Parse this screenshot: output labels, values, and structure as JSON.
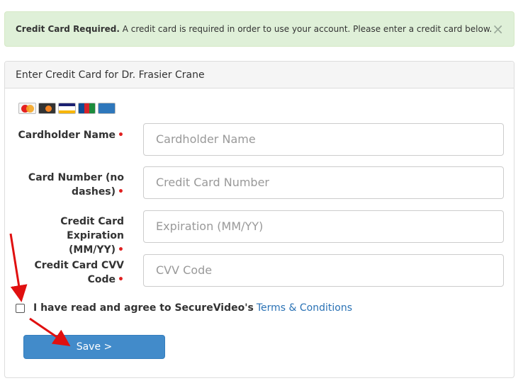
{
  "alert": {
    "title": "Credit Card Required.",
    "message": " A credit card is required in order to use your account. Please enter a credit card below.",
    "close_glyph": "×"
  },
  "panel": {
    "heading": "Enter Credit Card for Dr. Frasier Crane"
  },
  "card_logos": [
    "mastercard-icon",
    "discover-icon",
    "visa-icon",
    "jcb-icon",
    "amex-icon"
  ],
  "fields": {
    "cardholder_name": {
      "label": "Cardholder Name",
      "placeholder": "Cardholder Name"
    },
    "card_number": {
      "label_line1": "Card Number (no",
      "label_line2": "dashes)",
      "placeholder": "Credit Card Number"
    },
    "expiration": {
      "label_line1": "Credit Card Expiration",
      "label_line2": "(MM/YY)",
      "placeholder": "Expiration (MM/YY)"
    },
    "cvv": {
      "label_line1": "Credit Card CVV",
      "label_line2": "Code",
      "placeholder": "CVV Code"
    }
  },
  "required_marker": "•",
  "agree": {
    "text": "I have read and agree to SecureVideo's",
    "link": "Terms & Conditions"
  },
  "save_label": "Save >",
  "colors": {
    "alert_bg": "#dff0d8",
    "primary": "#428bca",
    "link": "#2a72b5",
    "required": "#e02020",
    "annotation_arrow": "#e01010"
  }
}
